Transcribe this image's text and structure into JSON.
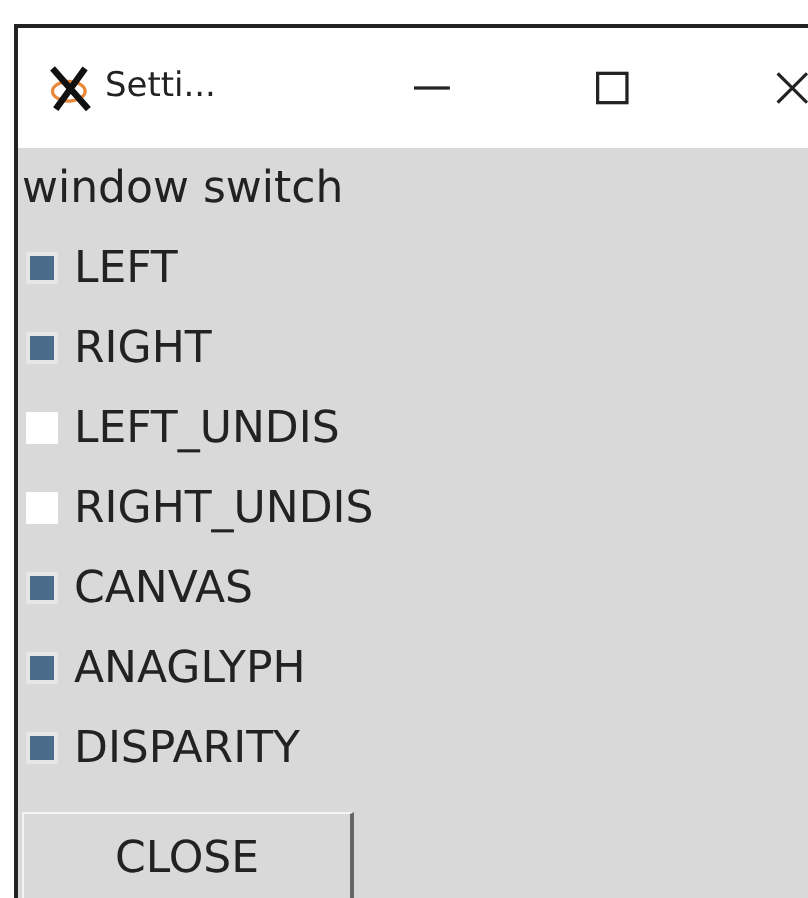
{
  "window": {
    "title": "Setti..."
  },
  "label": "window switch",
  "switches": [
    {
      "label": "LEFT",
      "checked": true
    },
    {
      "label": "RIGHT",
      "checked": true
    },
    {
      "label": "LEFT_UNDIS",
      "checked": false
    },
    {
      "label": "RIGHT_UNDIS",
      "checked": false
    },
    {
      "label": "CANVAS",
      "checked": true
    },
    {
      "label": "ANAGLYPH",
      "checked": true
    },
    {
      "label": "DISPARITY",
      "checked": true
    }
  ],
  "button": "CLOSE"
}
